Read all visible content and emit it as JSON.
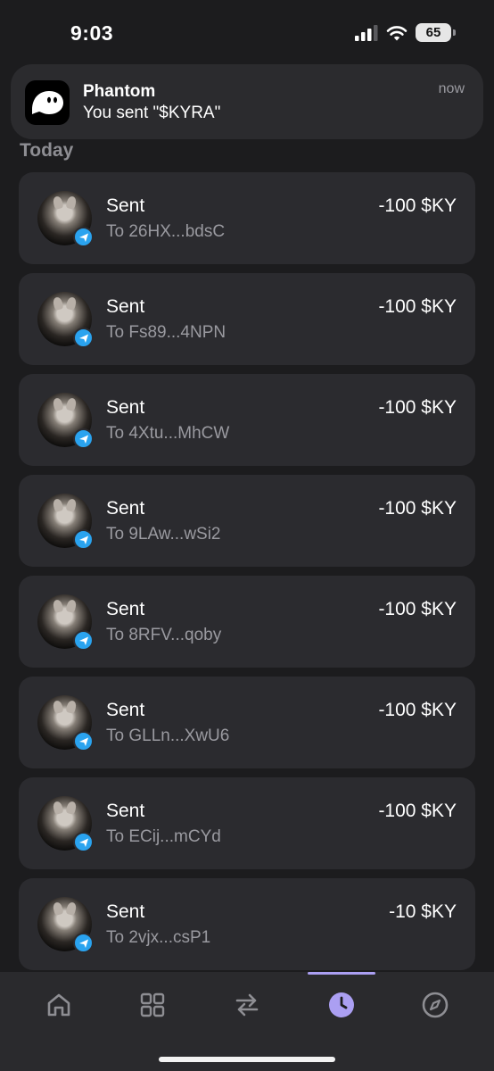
{
  "status_bar": {
    "time": "9:03",
    "battery": "65"
  },
  "notification": {
    "app": "Phantom",
    "message": "You sent \"$KYRA\"",
    "time": "now"
  },
  "section": {
    "title": "Today"
  },
  "transactions": [
    {
      "title": "Sent",
      "to": "To 26HX...bdsC",
      "amount": "-100 $KY"
    },
    {
      "title": "Sent",
      "to": "To Fs89...4NPN",
      "amount": "-100 $KY"
    },
    {
      "title": "Sent",
      "to": "To 4Xtu...MhCW",
      "amount": "-100 $KY"
    },
    {
      "title": "Sent",
      "to": "To 9LAw...wSi2",
      "amount": "-100 $KY"
    },
    {
      "title": "Sent",
      "to": "To 8RFV...qoby",
      "amount": "-100 $KY"
    },
    {
      "title": "Sent",
      "to": "To GLLn...XwU6",
      "amount": "-100 $KY"
    },
    {
      "title": "Sent",
      "to": "To ECij...mCYd",
      "amount": "-100 $KY"
    },
    {
      "title": "Sent",
      "to": "To 2vjx...csP1",
      "amount": "-10 $KY"
    }
  ],
  "tabs": [
    {
      "icon": "home-icon",
      "active": false
    },
    {
      "icon": "grid-icon",
      "active": false
    },
    {
      "icon": "swap-icon",
      "active": false
    },
    {
      "icon": "clock-icon",
      "active": true
    },
    {
      "icon": "compass-icon",
      "active": false
    }
  ],
  "colors": {
    "accent": "#ab9ff2",
    "badge": "#2aa3ef",
    "background": "#1c1c1e",
    "card": "#2b2b2f"
  }
}
